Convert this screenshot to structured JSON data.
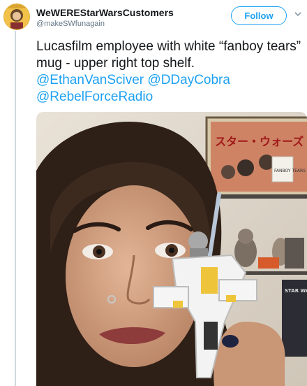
{
  "tweet": {
    "display_name": "WeWEREStarWarsCustomers",
    "handle": "@makeSWfunagain",
    "follow_label": "Follow",
    "text": "Lucasfilm employee with white “fanboy tears” mug - upper right top shelf.",
    "mentions": [
      "@EthanVanSciver",
      "@DDayCobra",
      "@RebelForceRadio"
    ]
  },
  "photo": {
    "poster_text": "スター・ウォーズ",
    "mug_text": "FANBOY TEARS",
    "book_text": "STAR WARS"
  },
  "colors": {
    "accent": "#1da1f2",
    "text": "#14171a",
    "muted": "#657786"
  },
  "icons": {
    "avatar": "avatar-image",
    "menu": "chevron-down-icon"
  }
}
